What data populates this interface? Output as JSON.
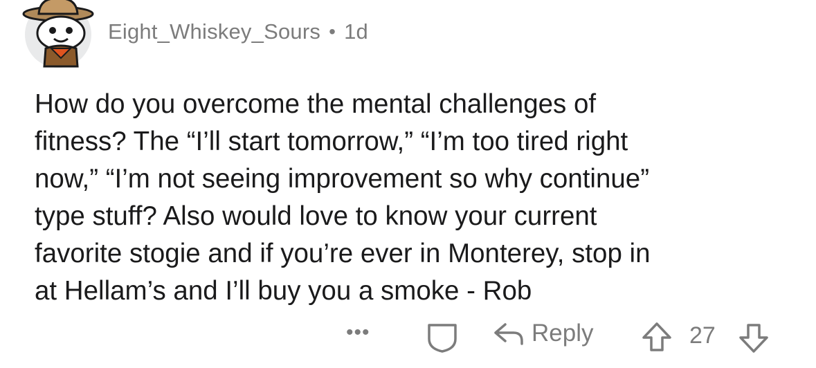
{
  "comment": {
    "username": "Eight_Whiskey_Sours",
    "separator": "•",
    "age": "1d",
    "body": "How do you overcome the mental challenges of\nfitness? The “I’ll start tomorrow,” “I’m too tired right\nnow,” “I’m not seeing improvement so why continue”\ntype stuff? Also would love to know your current\nfavorite stogie and if you’re ever in Monterey, stop in\nat Hellam’s and I’ll buy you a smoke - Rob",
    "avatar_icon": "cowboy-snoo-avatar"
  },
  "actions": {
    "more_label": "•••",
    "award_icon": "award-shield-icon",
    "reply_icon": "reply-arrow-icon",
    "reply_label": "Reply",
    "upvote_icon": "upvote-arrow-icon",
    "score": "27",
    "downvote_icon": "downvote-arrow-icon"
  },
  "colors": {
    "text": "#1a1a1b",
    "muted": "#7c7c7c",
    "avatar_bg": "#e9eaeb",
    "hat": "#b08a5a"
  }
}
